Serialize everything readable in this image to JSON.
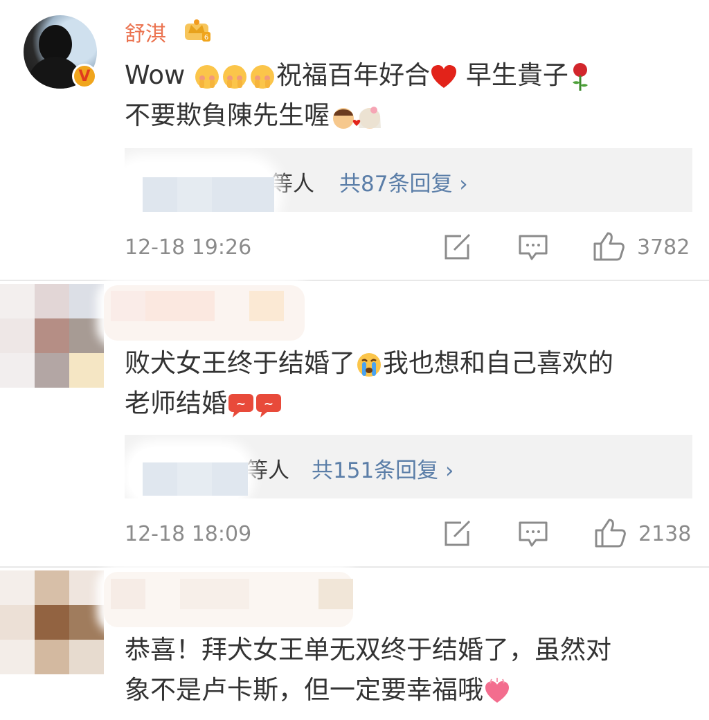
{
  "comments": [
    {
      "username": "舒淇",
      "line1_text": "Wow ",
      "line1_text2": "祝福百年好合",
      "line1_text3": " 早生貴子",
      "line2_text": "不要欺負陳先生喔",
      "reply_names_suffix": "等人",
      "reply_total": "共87条回复 ›",
      "time": "12-18 19:26",
      "likes": "3782",
      "icons": [
        "crown-vip-icon",
        "verified-badge-icon",
        "share-icon",
        "comment-icon",
        "like-icon"
      ]
    },
    {
      "line1_text": "败犬女王终于结婚了",
      "line1_text2": "我也想和自己喜欢的",
      "line2_text": "老师结婚",
      "reply_names_suffix": "等人",
      "reply_total": "共151条回复 ›",
      "time": "12-18 18:09",
      "likes": "2138"
    },
    {
      "line1_text": "恭喜！拜犬女王单无双终于结婚了，虽然对",
      "line2_text": "象不是卢卡斯，但一定要幸福哦"
    }
  ],
  "colors": {
    "username": "#eb7350",
    "link": "#5b7ea8",
    "meta": "#8b8b8b",
    "reply_bg": "#f2f2f2"
  }
}
